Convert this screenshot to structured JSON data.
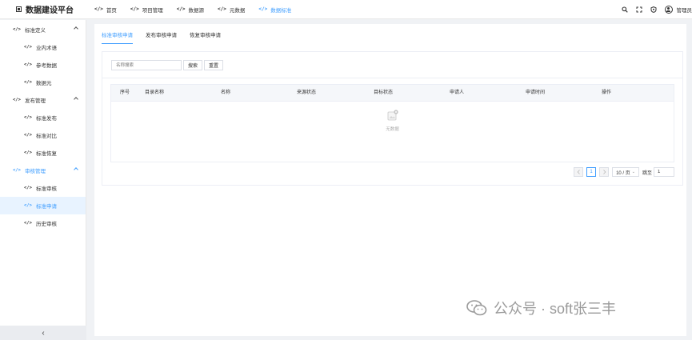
{
  "app": {
    "title": "数据建设平台"
  },
  "topnav": [
    {
      "label": "首页",
      "active": false
    },
    {
      "label": "项目管理",
      "active": false
    },
    {
      "label": "数据源",
      "active": false
    },
    {
      "label": "元数据",
      "active": false
    },
    {
      "label": "数据标准",
      "active": true
    }
  ],
  "header": {
    "user_label": "管理员",
    "icons": [
      "search-icon",
      "fullscreen-icon",
      "settings-icon"
    ]
  },
  "sidebar": {
    "groups": [
      {
        "label": "标准定义",
        "items": [
          "业内术语",
          "参考数据",
          "数据元"
        ]
      },
      {
        "label": "发布管理",
        "items": [
          "标准发布",
          "标准对比",
          "标准恢复"
        ]
      },
      {
        "label": "审核管理",
        "items": [
          "标准审核",
          "标准申请",
          "历史审核"
        ]
      }
    ],
    "collapse_glyph": "‹"
  },
  "tabs": [
    {
      "label": "标准审核申请",
      "active": true
    },
    {
      "label": "发布审核申请",
      "active": false
    },
    {
      "label": "恢复审核申请",
      "active": false
    }
  ],
  "search": {
    "placeholder": "名称搜索",
    "search_label": "搜索",
    "reset_label": "重置"
  },
  "table": {
    "columns": [
      "序号",
      "目录名称",
      "名称",
      "来源状态",
      "目标状态",
      "申请人",
      "申请时间",
      "操作"
    ],
    "empty_text": "无数据"
  },
  "pagination": {
    "current": "1",
    "page_size": "10 / 页",
    "jump_label": "跳至",
    "jump_value": "1"
  },
  "watermark": {
    "text": "公众号 · soft张三丰"
  },
  "colors": {
    "accent": "#409eff",
    "selected_bg": "#e8f3ff"
  }
}
